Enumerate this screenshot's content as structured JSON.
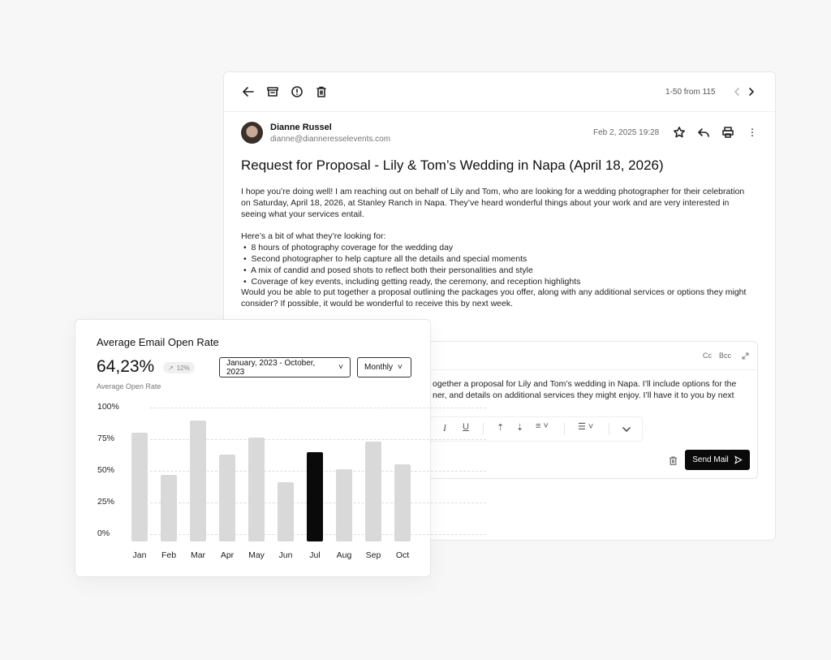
{
  "email": {
    "pagination": "1-50 from 115",
    "sender_name": "Dianne Russel",
    "sender_email": "dianne@dianneresselevents.com",
    "date": "Feb 2, 2025 19:28",
    "subject": "Request for Proposal - Lily & Tom’s Wedding in Napa (April 18, 2026)",
    "body_lines": [
      "I hope you’re doing well! I am reaching out on behalf of Lily and Tom, who are looking for a wedding photographer for their celebration",
      "on Saturday, April 18, 2026, at Stanley Ranch in Napa. They’ve heard wonderful things about your work and are very interested in",
      "seeing what your services entail."
    ],
    "list_intro": "Here’s a bit of what they’re looking for:",
    "list_items": [
      "8 hours of photography coverage for the wedding day",
      "Second photographer to help capture all the details and special moments",
      "A mix of candid and posed shots to reflect both their personalities and style",
      "Coverage of key events, including getting ready, the ceremony, and reception highlights"
    ],
    "closing_lines": [
      "Would you be able to put together a proposal outlining the packages you offer, along with any additional services or options they might",
      "consider? If possible, it would be wonderful to receive this by next week."
    ]
  },
  "composer": {
    "cc": "Cc",
    "bcc": "Bcc",
    "reply_lines": [
      "ogether a proposal for Lily and Tom’s wedding in Napa. I’ll include options for the",
      "ner, and details on additional services they might enjoy. I’ll have it to you by next"
    ],
    "send_label": "Send Mail"
  },
  "chart_card": {
    "title": "Average Email Open Rate",
    "value": "64,23%",
    "trend": "12%",
    "value_label": "Average Open Rate",
    "date_range": "January, 2023 - October, 2023",
    "interval": "Monthly"
  },
  "chart_data": {
    "type": "bar",
    "categories": [
      "Jan",
      "Feb",
      "Mar",
      "Apr",
      "May",
      "Jun",
      "Jul",
      "Aug",
      "Sep",
      "Oct"
    ],
    "values": [
      80,
      47,
      90,
      63,
      76,
      41,
      65,
      51,
      73,
      55
    ],
    "highlighted": "Jul",
    "ylim": [
      0,
      100
    ],
    "yticks": [
      "100%",
      "75%",
      "50%",
      "25%",
      "0%"
    ],
    "grid": true,
    "colors": {
      "bar": "#d9d9d9",
      "highlight": "#0a0a0a"
    }
  }
}
